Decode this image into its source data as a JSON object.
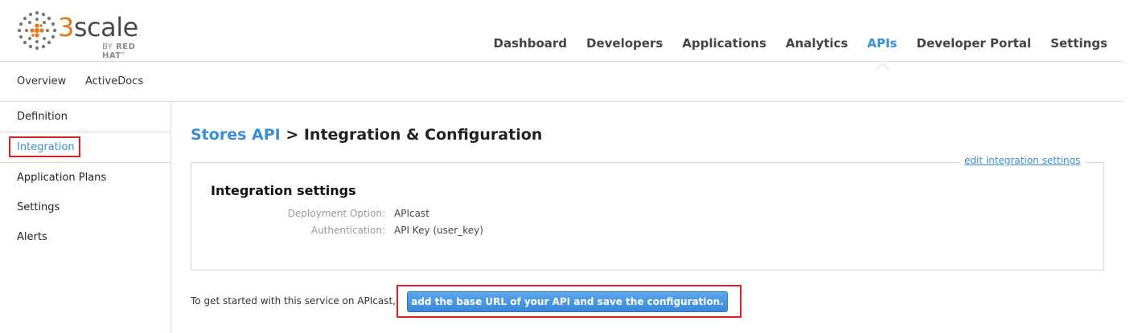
{
  "logo": {
    "brand_digit": "3",
    "brand_text": "scale",
    "by": "BY",
    "by_bold": "RED HAT",
    "tm": "°"
  },
  "topnav": [
    "Dashboard",
    "Developers",
    "Applications",
    "Analytics",
    "APIs",
    "Developer Portal",
    "Settings"
  ],
  "topnav_active": "APIs",
  "subnav": {
    "overview": "Overview",
    "activedocs": "ActiveDocs"
  },
  "sidebar": {
    "items": [
      "Definition",
      "Integration",
      "Application Plans",
      "Settings",
      "Alerts"
    ],
    "active": "Integration"
  },
  "page": {
    "title_link": "Stores API",
    "title_rest": " > Integration & Configuration"
  },
  "panel": {
    "edit_link": "edit integration settings",
    "heading": "Integration settings",
    "rows": [
      {
        "label": "Deployment Option:",
        "value": "APIcast"
      },
      {
        "label": "Authentication:",
        "value": "API Key (user_key)"
      }
    ]
  },
  "cta": {
    "text": "To get started with this service on APIcast,",
    "button": "add the base URL of your API and save the configuration."
  },
  "colors": {
    "accent": "#3a8ed8",
    "logo_orange": "#e8761c",
    "highlight": "#e0201f"
  },
  "icons": {
    "logo_mark": "3scale-dots-icon",
    "active_caret": "caret-up-icon"
  }
}
